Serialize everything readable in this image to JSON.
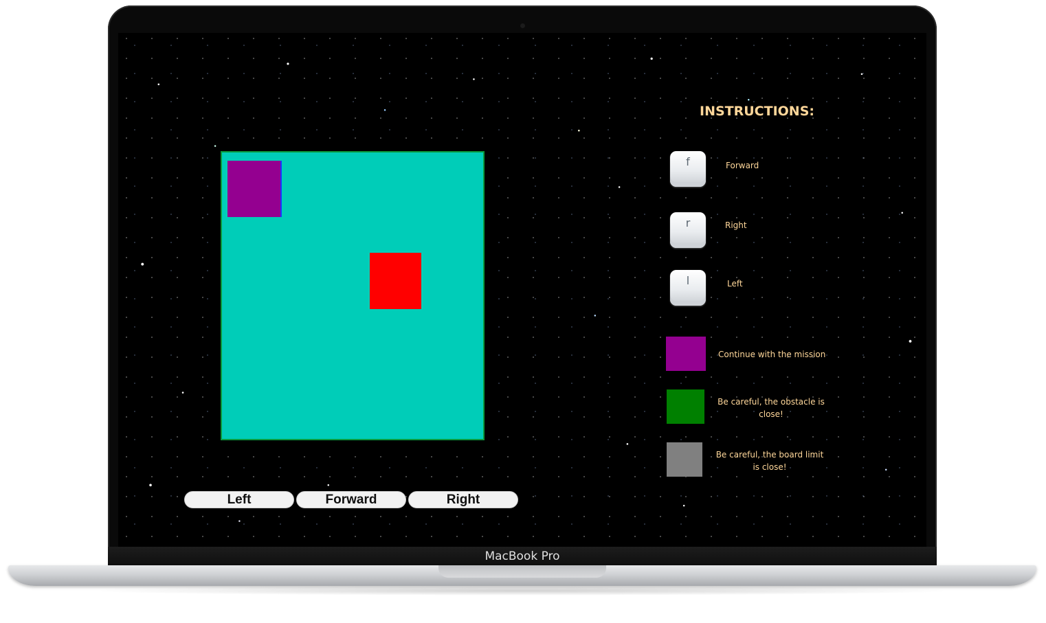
{
  "device": {
    "brand_label": "MacBook Pro"
  },
  "game": {
    "board_color": "#00cdb8",
    "rover_color": "#940090",
    "obstacle_color": "#ff0000",
    "controls": {
      "left": "Left",
      "forward": "Forward",
      "right": "Right"
    }
  },
  "instructions": {
    "title": "INSTRUCTIONS:",
    "keys": [
      {
        "key": "f",
        "label": "Forward"
      },
      {
        "key": "r",
        "label": "Right"
      },
      {
        "key": "l",
        "label": "Left"
      }
    ],
    "colors": [
      {
        "color": "#940090",
        "label": "Continue with the mission"
      },
      {
        "color": "#008000",
        "label": "Be careful, the obstacle is close!"
      },
      {
        "color": "#808080",
        "label": "Be careful, the board limit is close!"
      }
    ]
  }
}
